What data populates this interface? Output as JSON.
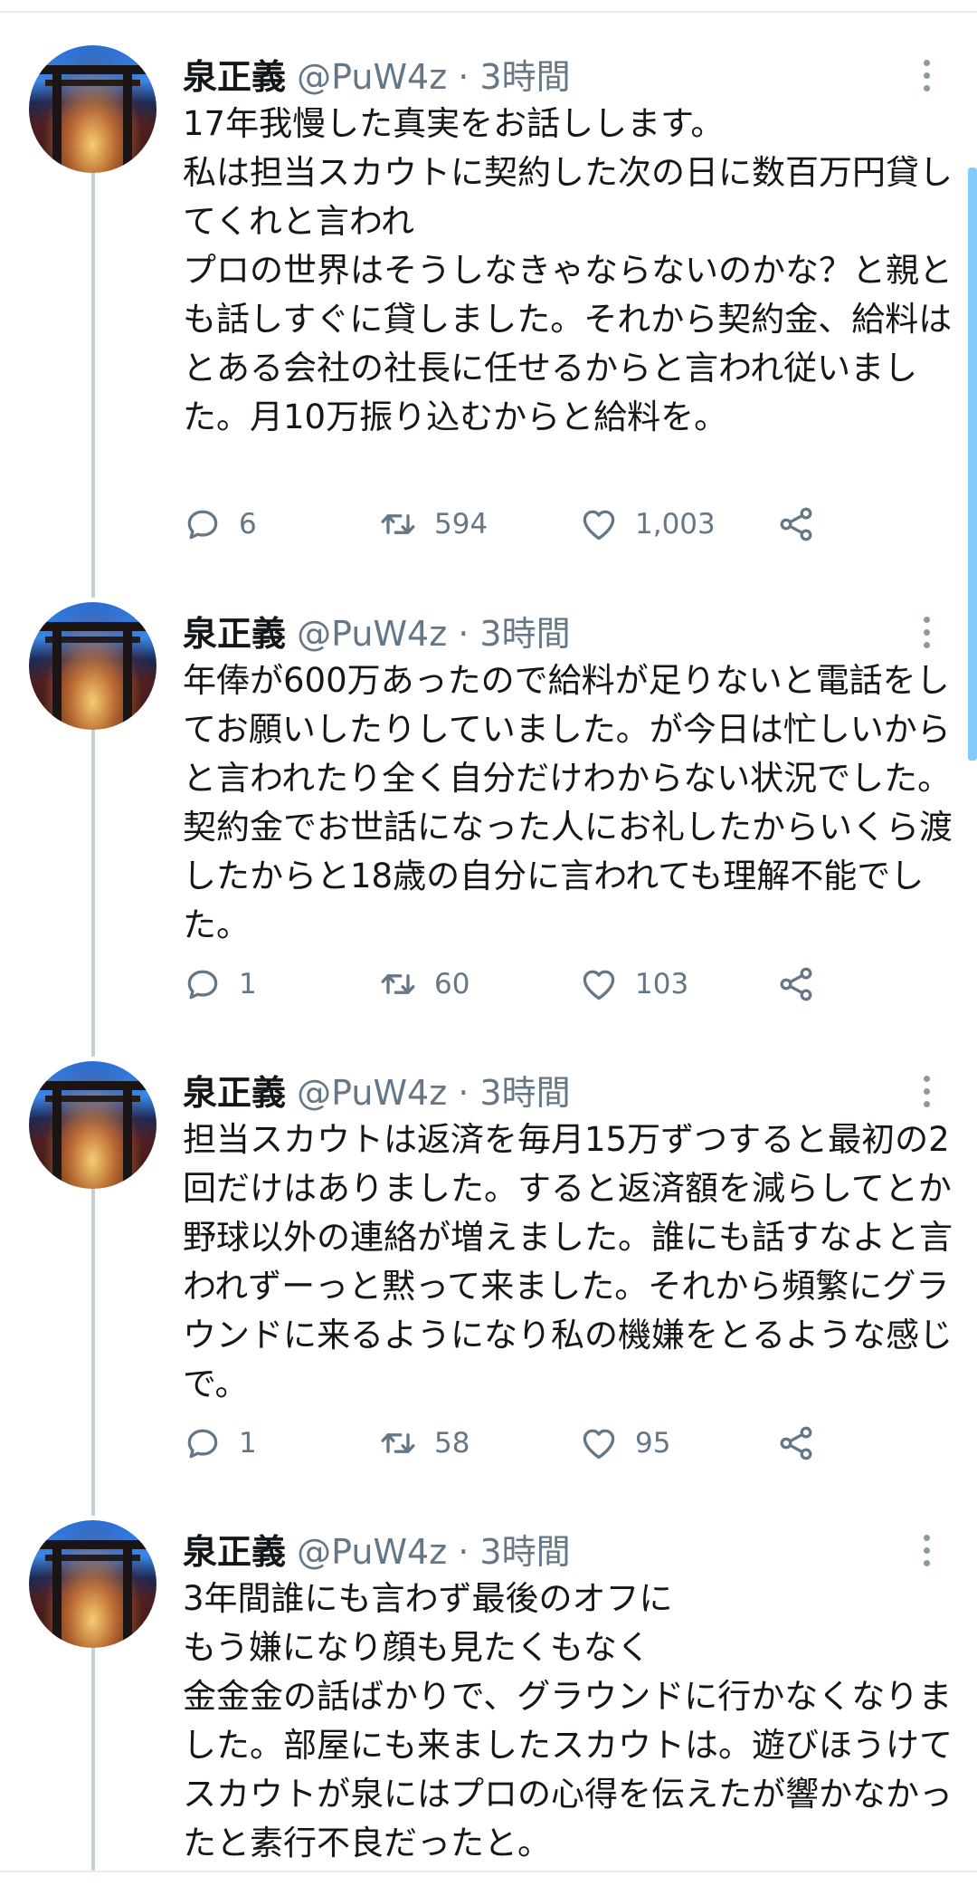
{
  "tweets": [
    {
      "name": "泉正義",
      "handle": "@PuW4z",
      "time": "3時間",
      "text": "17年我慢した真実をお話しします。\n私は担当スカウトに契約した次の日に数百万円貸してくれと言われ\nプロの世界はそうしなきゃならないのかな？と親とも話しすぐに貸しました。それから契約金、給料はとある会社の社長に任せるからと言われ従いました。月10万振り込むからと給料を。",
      "replies": "6",
      "retweets": "594",
      "likes": "1,003"
    },
    {
      "name": "泉正義",
      "handle": "@PuW4z",
      "time": "3時間",
      "text": "年俸が600万あったので給料が足りないと電話をしてお願いしたりしていました。が今日は忙しいからと言われたり全く自分だけわからない状況でした。契約金でお世話になった人にお礼したからいくら渡したからと18歳の自分に言われても理解不能でした。",
      "replies": "1",
      "retweets": "60",
      "likes": "103"
    },
    {
      "name": "泉正義",
      "handle": "@PuW4z",
      "time": "3時間",
      "text": "担当スカウトは返済を毎月15万ずつすると最初の2回だけはありました。すると返済額を減らしてとか野球以外の連絡が増えました。誰にも話すなよと言われずーっと黙って来ました。それから頻繁にグラウンドに来るようになり私の機嫌をとるような感じで。",
      "replies": "1",
      "retweets": "58",
      "likes": "95"
    },
    {
      "name": "泉正義",
      "handle": "@PuW4z",
      "time": "3時間",
      "text": "3年間誰にも言わず最後のオフに\nもう嫌になり顔も見たくもなく\n金金金の話ばかりで、グラウンドに行かなくなりました。部屋にも来ましたスカウトは。遊びほうけてスカウトが泉にはプロの心得を伝えたが響かなかったと素行不良だったと。"
    }
  ],
  "colors": {
    "text": "#14171a",
    "meta": "#657786",
    "thread_line": "#c4cfd6",
    "accent": "#1da1f2"
  },
  "icons": [
    "reply-icon",
    "retweet-icon",
    "like-icon",
    "share-icon",
    "more-icon"
  ]
}
